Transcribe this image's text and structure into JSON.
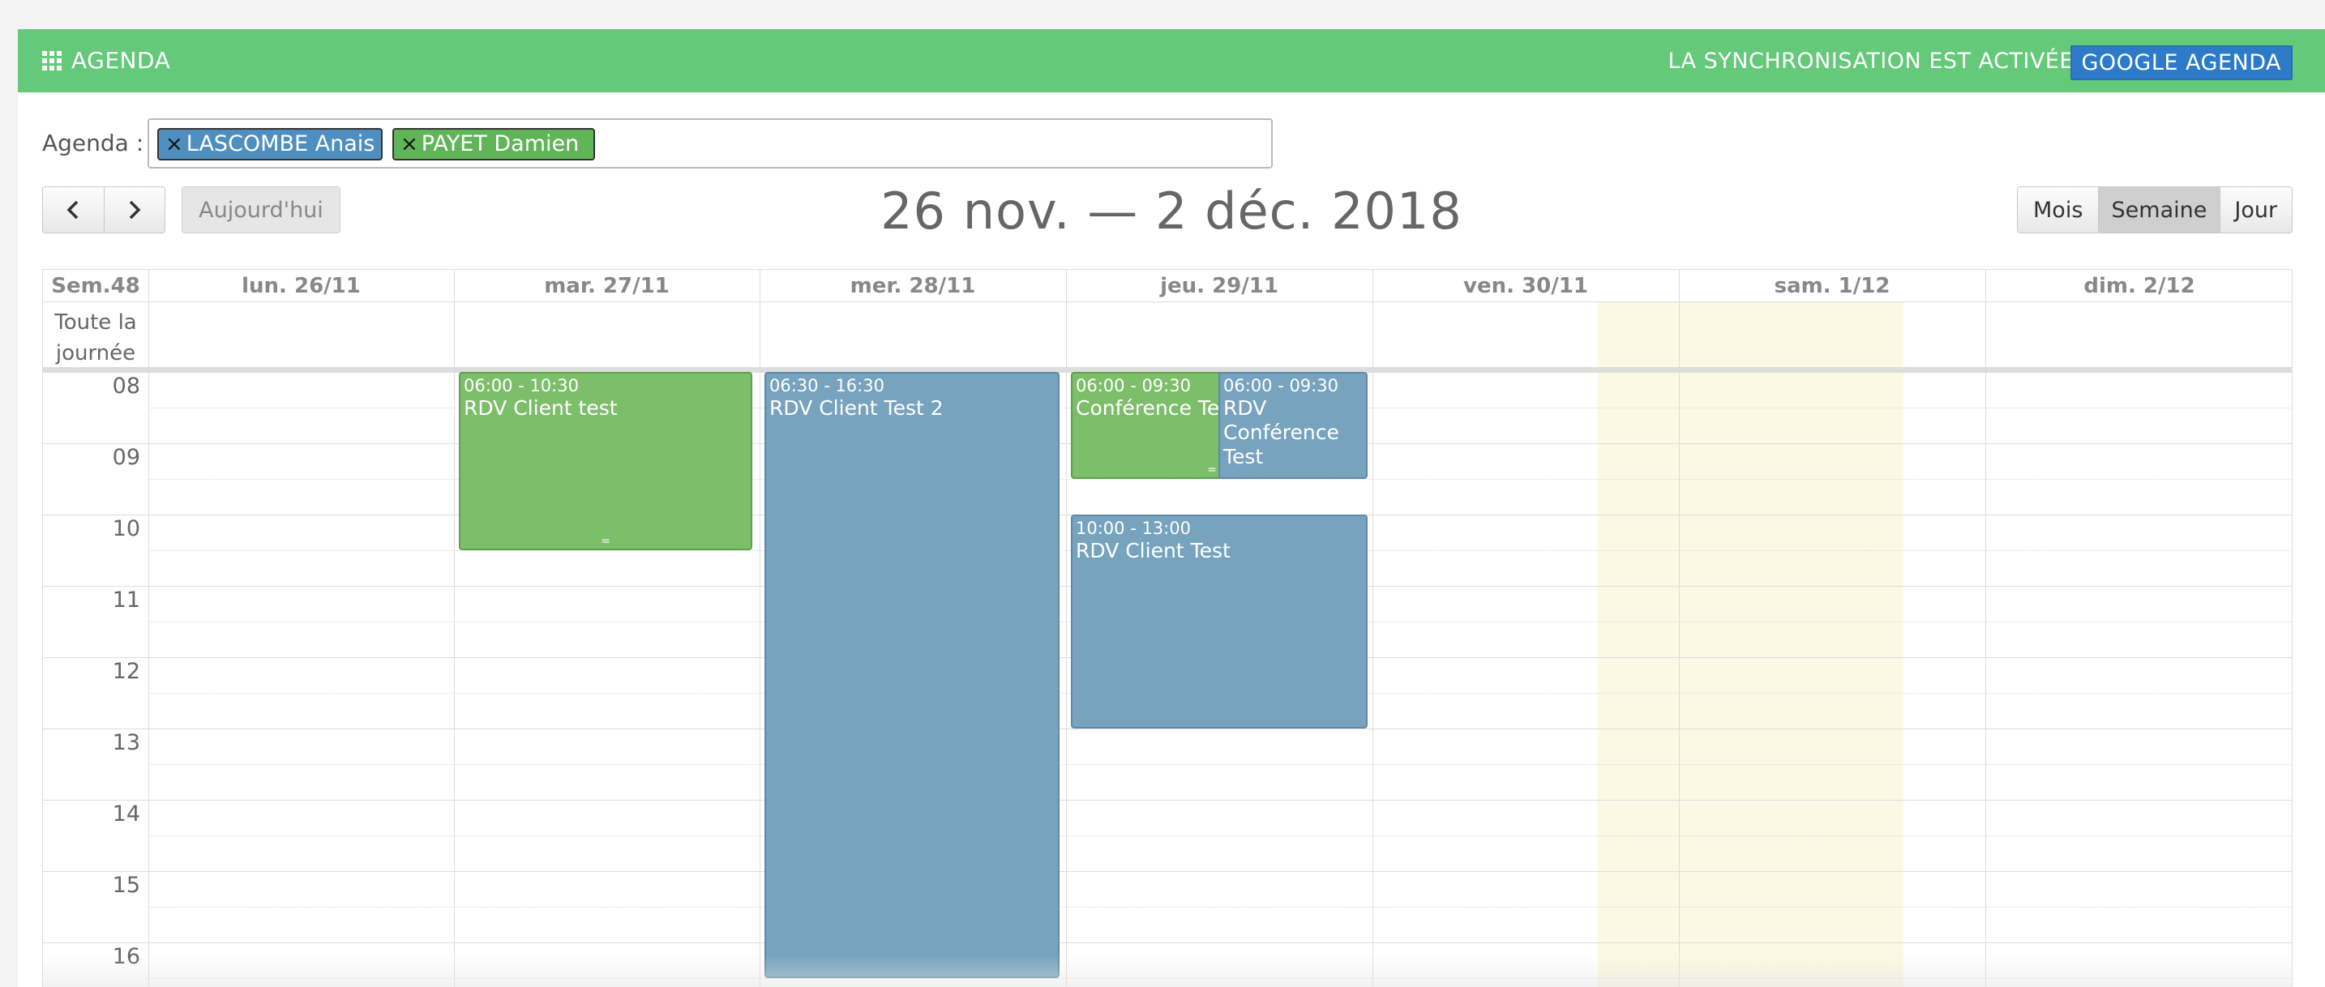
{
  "header": {
    "app_title": "AGENDA",
    "sync_text": "LA SYNCHRONISATION EST ACTIVÉE",
    "google_button": "GOOGLE AGENDA",
    "color": "#65c97a"
  },
  "agenda_filter": {
    "label": "Agenda :",
    "tags": [
      {
        "name": "LASCOMBE Anais",
        "color": "#4e8fbf",
        "remove": "×"
      },
      {
        "name": "PAYET Damien",
        "color": "#60b558",
        "remove": "×"
      }
    ]
  },
  "toolbar": {
    "prev": "‹",
    "next": "›",
    "today": "Aujourd'hui",
    "range_title": "26 nov. — 2 déc. 2018",
    "views": [
      "Mois",
      "Semaine",
      "Jour"
    ],
    "active_view": "Semaine"
  },
  "calendar": {
    "week_label": "Sem.48",
    "allday_label_line1": "Toute la",
    "allday_label_line2": "journée",
    "days": [
      "lun. 26/11",
      "mar. 27/11",
      "mer. 28/11",
      "jeu. 29/11",
      "ven. 30/11",
      "sam. 1/12",
      "dim. 2/12"
    ],
    "today": "sam. 1/12",
    "hours": [
      "08",
      "09",
      "10",
      "11",
      "12",
      "13",
      "14",
      "15",
      "16"
    ],
    "events": [
      {
        "time": "06:00 - 10:30",
        "title": "RDV Client test",
        "day": "mar. 27/11",
        "owner": "PAYET Damien",
        "color": "#7dbe6a"
      },
      {
        "time": "06:30 - 16:30",
        "title": "RDV Client Test 2",
        "day": "mer. 28/11",
        "owner": "LASCOMBE Anais",
        "color": "#77a3bf"
      },
      {
        "time": "06:00 - 09:30",
        "title": "Conférence Test",
        "day": "jeu. 29/11",
        "owner": "PAYET Damien",
        "color": "#7dbe6a"
      },
      {
        "time": "06:00 - 09:30",
        "title_line1": "RDV",
        "title_line2": "Conférence",
        "title_line3": "Test",
        "day": "jeu. 29/11",
        "owner": "LASCOMBE Anais",
        "color": "#77a3bf"
      },
      {
        "time": "10:00 - 13:00",
        "title": "RDV Client Test",
        "day": "jeu. 29/11",
        "owner": "LASCOMBE Anais",
        "color": "#77a3bf"
      }
    ],
    "resize_grip": "="
  }
}
